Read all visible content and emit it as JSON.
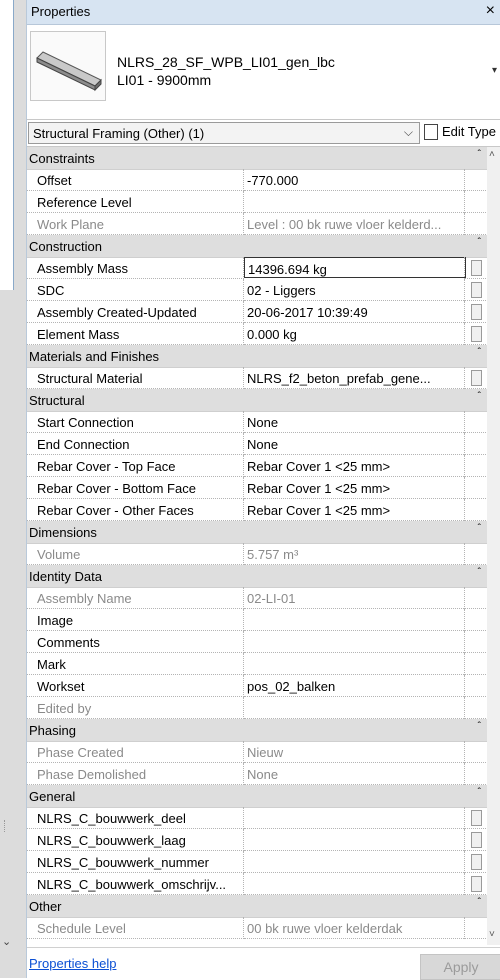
{
  "titlebar": {
    "title": "Properties",
    "close": "×"
  },
  "type_selector": {
    "name": "NLRS_28_SF_WPB_LI01_gen_lbc",
    "type": "LI01 - 9900mm",
    "dropdown": "▾"
  },
  "selection": {
    "label": "Structural Framing (Other) (1)",
    "chevron": "⌵",
    "edit_type": "Edit Type"
  },
  "footer": {
    "help": "Properties help",
    "apply": "Apply"
  },
  "groups": [
    {
      "name": "Constraints",
      "props": [
        {
          "name": "Offset",
          "value": "-770.000",
          "ro": false
        },
        {
          "name": "Reference Level",
          "value": "",
          "ro": false
        },
        {
          "name": "Work Plane",
          "value": "Level : 00 bk ruwe vloer kelderd...",
          "ro": true
        }
      ]
    },
    {
      "name": "Construction",
      "props": [
        {
          "name": "Assembly Mass",
          "value": "14396.694 kg",
          "ro": false,
          "btn": true,
          "active": true
        },
        {
          "name": "SDC",
          "value": "02 - Liggers",
          "ro": false,
          "btn": true
        },
        {
          "name": "Assembly Created-Updated",
          "value": "20-06-2017 10:39:49",
          "ro": false,
          "btn": true
        },
        {
          "name": "Element Mass",
          "value": "0.000 kg",
          "ro": false,
          "btn": true
        }
      ]
    },
    {
      "name": "Materials and Finishes",
      "props": [
        {
          "name": "Structural Material",
          "value": "NLRS_f2_beton_prefab_gene...",
          "ro": false,
          "btn": true
        }
      ]
    },
    {
      "name": "Structural",
      "props": [
        {
          "name": "Start Connection",
          "value": "None",
          "ro": false
        },
        {
          "name": "End Connection",
          "value": "None",
          "ro": false
        },
        {
          "name": "Rebar Cover - Top Face",
          "value": "Rebar Cover 1 <25 mm>",
          "ro": false
        },
        {
          "name": "Rebar Cover - Bottom Face",
          "value": "Rebar Cover 1 <25 mm>",
          "ro": false
        },
        {
          "name": "Rebar Cover - Other Faces",
          "value": "Rebar Cover 1 <25 mm>",
          "ro": false
        }
      ]
    },
    {
      "name": "Dimensions",
      "props": [
        {
          "name": "Volume",
          "value": "5.757 m³",
          "ro": true
        }
      ]
    },
    {
      "name": "Identity Data",
      "props": [
        {
          "name": "Assembly Name",
          "value": "02-LI-01",
          "ro": true
        },
        {
          "name": "Image",
          "value": "",
          "ro": false
        },
        {
          "name": "Comments",
          "value": "",
          "ro": false
        },
        {
          "name": "Mark",
          "value": "",
          "ro": false
        },
        {
          "name": "Workset",
          "value": "pos_02_balken",
          "ro": false
        },
        {
          "name": "Edited by",
          "value": "",
          "ro": true
        }
      ]
    },
    {
      "name": "Phasing",
      "props": [
        {
          "name": "Phase Created",
          "value": "Nieuw",
          "ro": true
        },
        {
          "name": "Phase Demolished",
          "value": "None",
          "ro": true
        }
      ]
    },
    {
      "name": "General",
      "props": [
        {
          "name": "NLRS_C_bouwwerk_deel",
          "value": "",
          "ro": false,
          "btn": true
        },
        {
          "name": "NLRS_C_bouwwerk_laag",
          "value": "",
          "ro": false,
          "btn": true
        },
        {
          "name": "NLRS_C_bouwwerk_nummer",
          "value": "",
          "ro": false,
          "btn": true
        },
        {
          "name": "NLRS_C_bouwwerk_omschrijv...",
          "value": "",
          "ro": false,
          "btn": true
        }
      ]
    },
    {
      "name": "Other",
      "props": [
        {
          "name": "Schedule Level",
          "value": "00 bk ruwe vloer kelderdak",
          "ro": true
        }
      ]
    }
  ],
  "toggle_glyph": "ˆ",
  "colors": {
    "group_bg": "#dedede",
    "header_bg": "#d7e4f2",
    "link": "#0b4fd4"
  }
}
